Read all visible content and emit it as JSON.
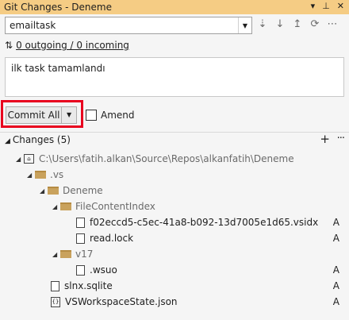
{
  "window": {
    "title": "Git Changes - Deneme",
    "icons": [
      "chevron-down-icon",
      "pin-icon",
      "close-icon"
    ]
  },
  "branch": {
    "name": "emailtask"
  },
  "actions": [
    "fetch-icon",
    "pull-icon",
    "push-icon",
    "sync-icon",
    "more-actions-icon"
  ],
  "sync": {
    "text": "0 outgoing / 0 incoming"
  },
  "commit_message": "ilk task tamamlandı",
  "commit": {
    "button_label": "Commit All",
    "amend_label": "Amend"
  },
  "changes": {
    "header": "Changes (5)"
  },
  "tree": [
    {
      "label": "C:\\Users\\fatih.alkan\\Source\\Repos\\alkanfatih\\Deneme",
      "status": ""
    },
    {
      "label": ".vs",
      "status": ""
    },
    {
      "label": "Deneme",
      "status": ""
    },
    {
      "label": "FileContentIndex",
      "status": ""
    },
    {
      "label": "f02eccd5-c5ec-41a8-b092-13d7005e1d65.vsidx",
      "status": "A"
    },
    {
      "label": "read.lock",
      "status": "A"
    },
    {
      "label": "v17",
      "status": ""
    },
    {
      "label": ".wsuo",
      "status": "A"
    },
    {
      "label": "slnx.sqlite",
      "status": "A"
    },
    {
      "label": "VSWorkspaceState.json",
      "status": "A"
    }
  ],
  "colors": {
    "title_bar": "#f5cc84",
    "highlight_box": "#e8001e"
  }
}
